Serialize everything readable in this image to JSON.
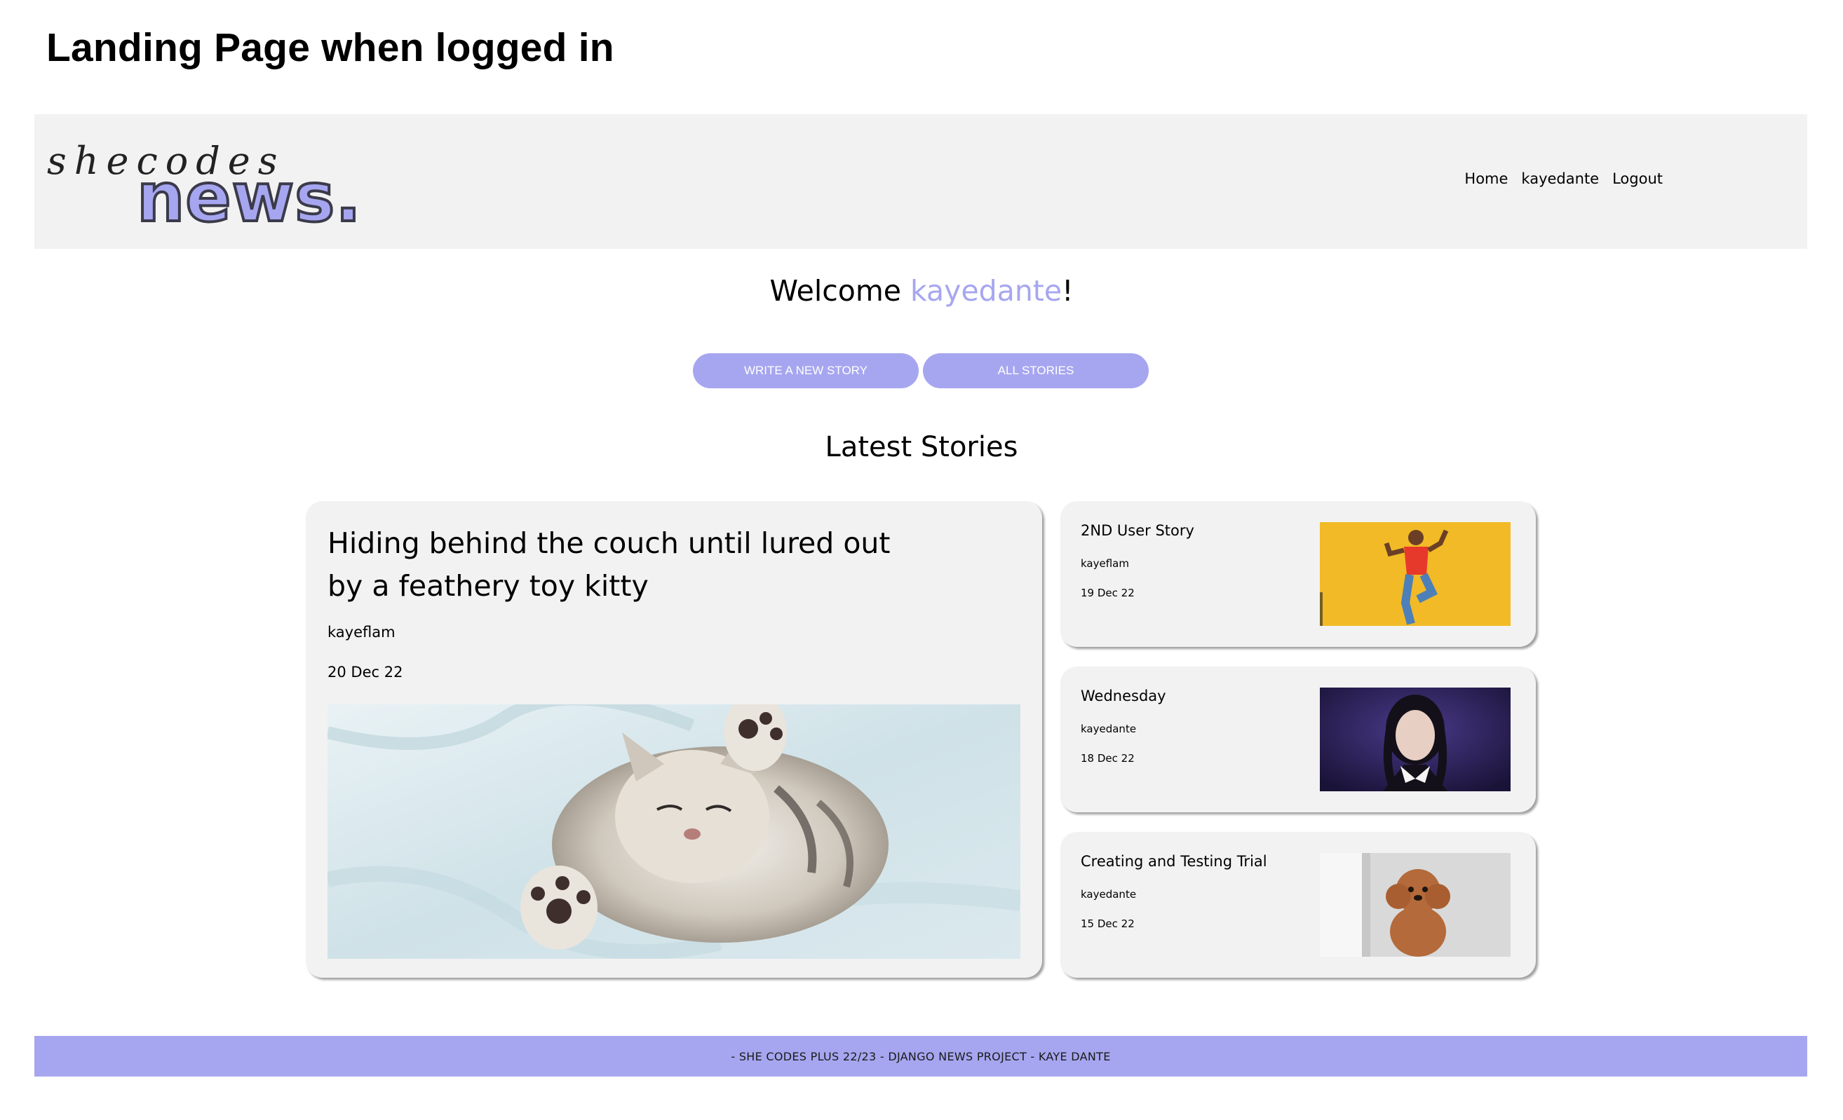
{
  "page": {
    "heading": "Landing Page when logged in"
  },
  "navbar": {
    "logo_script": "shecodes",
    "logo_brand": "news.",
    "links": [
      "Home",
      "kayedante",
      "Logout"
    ]
  },
  "welcome": {
    "prefix": "Welcome ",
    "username": "kayedante",
    "suffix": "!"
  },
  "actions": {
    "write_label": "WRITE A NEW STORY",
    "all_label": "ALL STORIES"
  },
  "latest": {
    "heading": "Latest Stories",
    "featured": {
      "title": "Hiding behind the couch until lured out by a feathery toy kitty",
      "author": "kayeflam",
      "date": "20 Dec 22",
      "image": "kitten-photo"
    },
    "stories": [
      {
        "title": "2ND User Story",
        "author": "kayeflam",
        "date": "19 Dec 22",
        "image": "dancer-photo"
      },
      {
        "title": "Wednesday",
        "author": "kayedante",
        "date": "18 Dec 22",
        "image": "wednesday-portrait"
      },
      {
        "title": "Creating and Testing Trial",
        "author": "kayedante",
        "date": "15 Dec 22",
        "image": "poodle-photo"
      }
    ]
  },
  "footer": {
    "text": "- SHE CODES PLUS 22/23 - DJANGO NEWS PROJECT - KAYE DANTE"
  },
  "colors": {
    "accent": "#a6a6f0",
    "panel": "#f2f2f2"
  }
}
